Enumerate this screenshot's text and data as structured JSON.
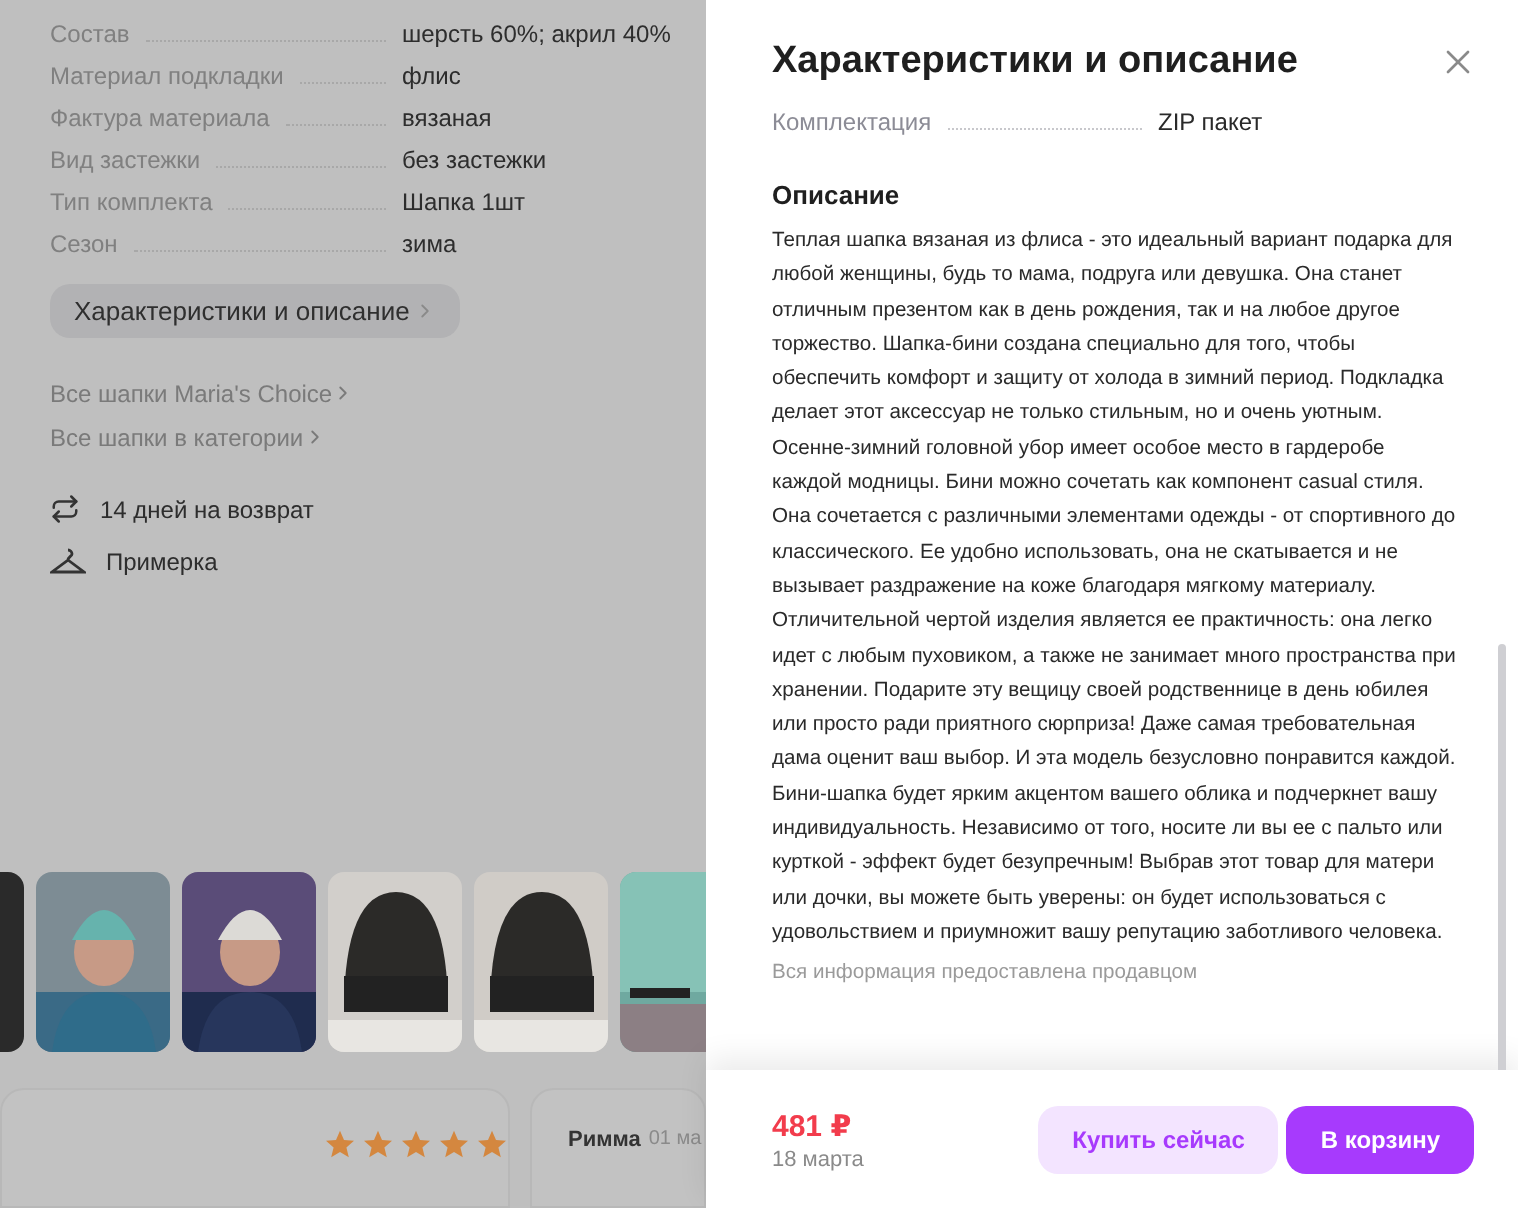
{
  "product": {
    "specs": [
      {
        "label": "Состав",
        "value": "шерсть 60%; акрил 40%"
      },
      {
        "label": "Материал подкладки",
        "value": "флис"
      },
      {
        "label": "Фактура материала",
        "value": "вязаная"
      },
      {
        "label": "Вид застежки",
        "value": "без застежки"
      },
      {
        "label": "Тип комплекта",
        "value": "Шапка 1шт"
      },
      {
        "label": "Сезон",
        "value": "зима"
      }
    ],
    "details_button": "Характеристики и описание",
    "links": [
      "Все шапки Maria's Choice",
      "Все шапки в категории"
    ],
    "perks": [
      {
        "kind": "return",
        "text": "14 дней на возврат"
      },
      {
        "kind": "fitting",
        "text": "Примерка"
      }
    ],
    "reviews": [
      {
        "stars": 5
      },
      {
        "author": "Римма",
        "date": "01 ма"
      }
    ]
  },
  "drawer": {
    "title": "Характеристики и описание",
    "specs": [
      {
        "label": "Комплектация",
        "value": "ZIP пакет"
      }
    ],
    "description_heading": "Описание",
    "description": "Теплая шапка вязаная из флиса - это идеальный вариант подарка для любой женщины, будь то мама, подруга или девушка. Она станет отличным презентом как в день рождения, так и на любое другое торжество. Шапка-бини создана специально для того, чтобы обеспечить комфорт и защиту от холода в зимний период. Подкладка делает этот аксессуар не только стильным, но и очень уютным. Осенне-зимний головной убор имеет особое место в гардеробе каждой модницы. Бини можно сочетать как компонент casual стиля. Она сочетается с различными элементами одежды - от спортивного до классического. Ее удобно использовать, она не скатывается и не вызывает раздражение на коже благодаря мягкому материалу. Отличительной чертой изделия является ее практичность: она легко идет с любым пуховиком, а также не занимает много пространства при хранении. Подарите эту вещицу своей родственнице в день юбилея или просто ради приятного сюрприза! Даже самая требовательная дама оценит ваш выбор. И эта модель безусловно понравится каждой. Бини-шапка будет ярким акцентом вашего облика и подчеркнет вашу индивидуальность. Независимо от того, носите ли вы ее с пальто или курткой - эффект будет безупречным! Выбрав этот товар для матери или дочки, вы можете быть уверены: он будет использоваться с удовольствием и приумножит вашу репутацию заботливого человека.",
    "seller_note": "Вся информация предоставлена продавцом",
    "price": "481 ₽",
    "delivery": "18 марта",
    "buttons": [
      {
        "kind": "secondary",
        "label": "Купить сейчас"
      },
      {
        "kind": "primary",
        "label": "В корзину"
      }
    ]
  }
}
